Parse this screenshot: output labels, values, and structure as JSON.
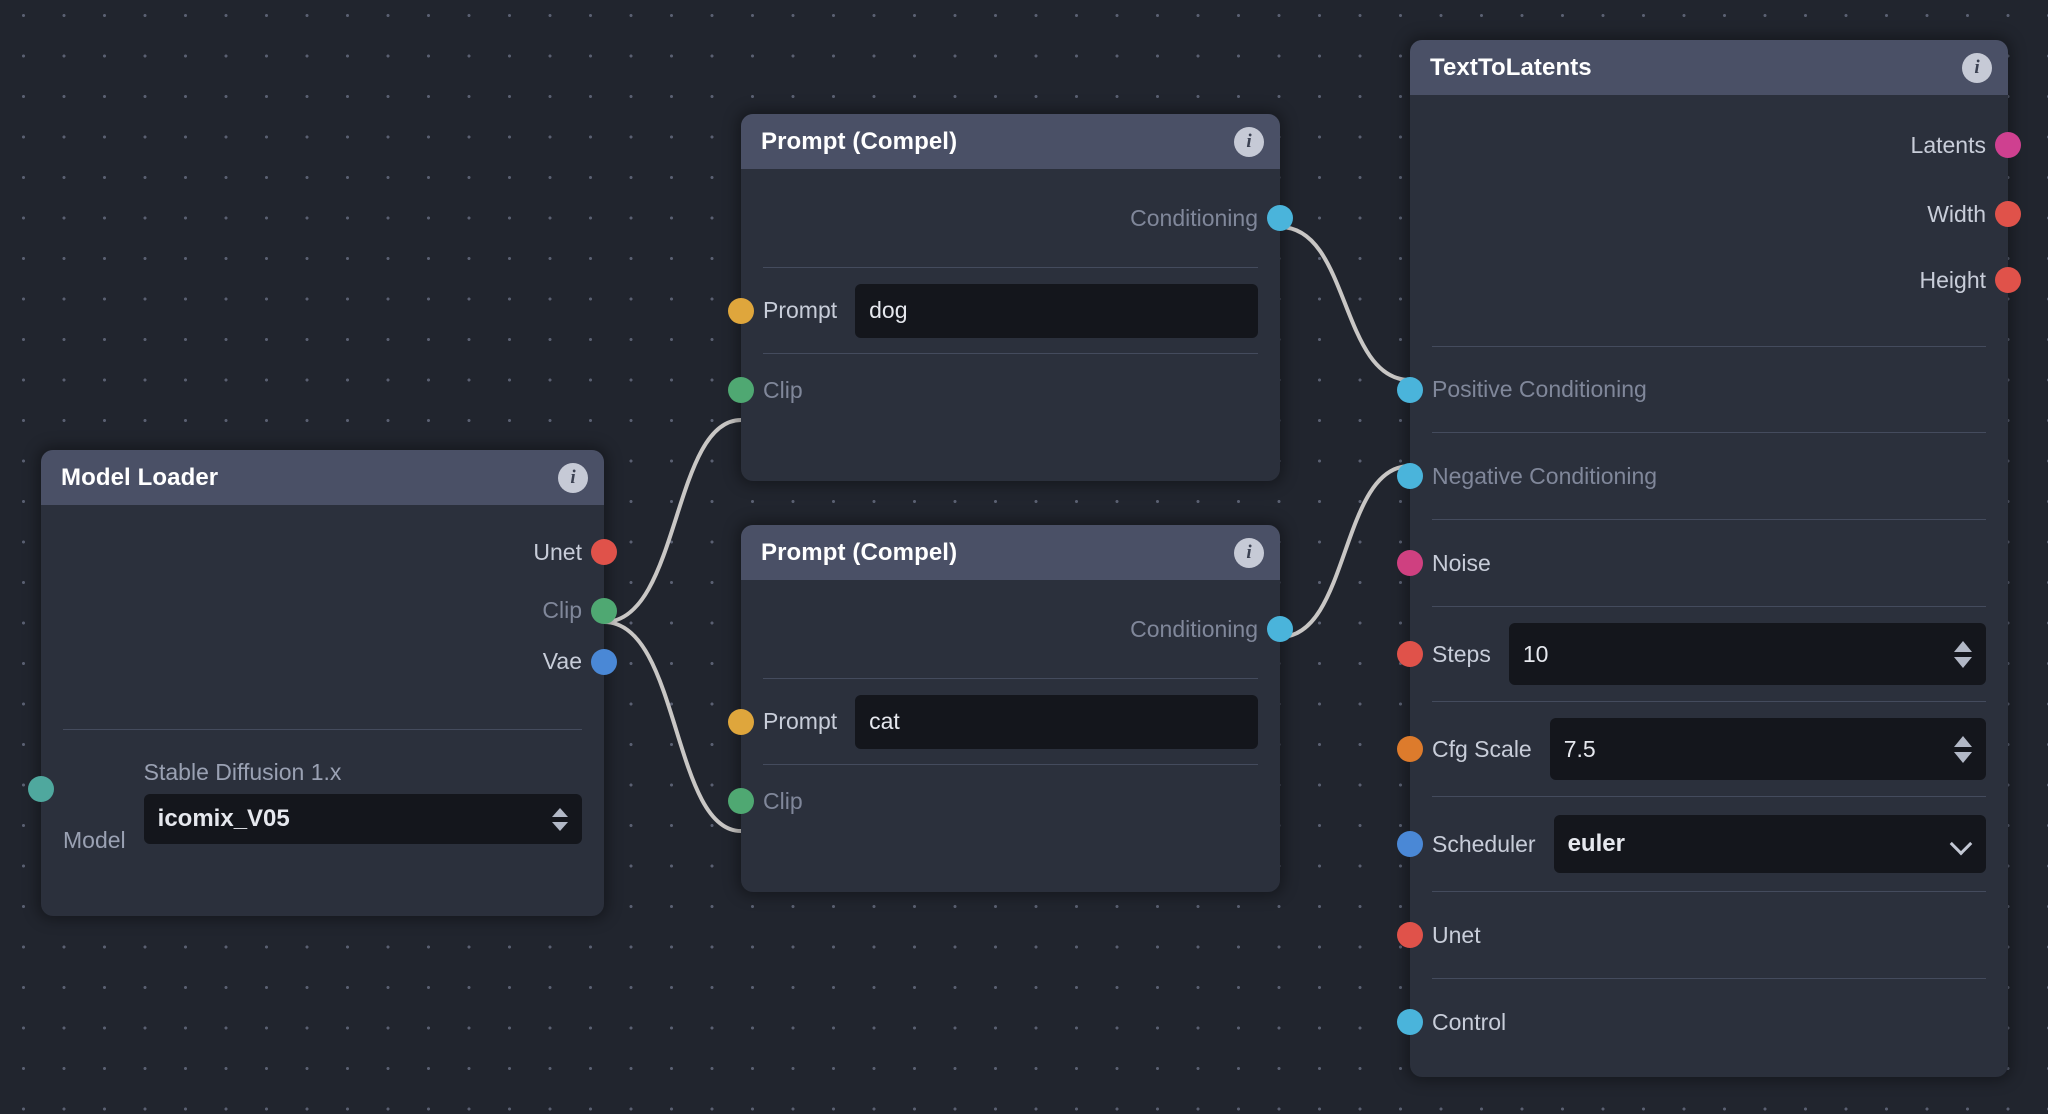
{
  "app": {
    "canvas_name": "node-graph-canvas",
    "background_color": "#21252e",
    "grid_dot_color": "#5a6072"
  },
  "socket_colors": {
    "unet": "#e0524a",
    "clip": "#4fa872",
    "vae": "#4a88d6",
    "model": "#4fa89e",
    "prompt": "#dfa63c",
    "conditioning": "#4ab4db",
    "latents": "#cf4090",
    "noise": "#cf4080",
    "width": "#e0524a",
    "height": "#e0524a",
    "steps": "#e0524a",
    "cfg_scale": "#dd7b2c",
    "scheduler": "#4a88d6",
    "control": "#4ab4db"
  },
  "nodes": {
    "model_loader": {
      "title": "Model Loader",
      "info_glyph": "i",
      "outputs": [
        {
          "label": "Unet",
          "socket": "unet",
          "state": "bright"
        },
        {
          "label": "Clip",
          "socket": "clip",
          "state": "dim"
        },
        {
          "label": "Vae",
          "socket": "vae",
          "state": "bright"
        }
      ],
      "model_input": {
        "socket": "model",
        "label": "Model",
        "base_model": "Stable Diffusion 1.x",
        "value": "icomix_V05"
      }
    },
    "prompt_positive": {
      "title": "Prompt (Compel)",
      "info_glyph": "i",
      "outputs": [
        {
          "label": "Conditioning",
          "socket": "conditioning",
          "state": "dim"
        }
      ],
      "inputs": [
        {
          "label": "Prompt",
          "socket": "prompt",
          "state": "bright",
          "value": "dog"
        },
        {
          "label": "Clip",
          "socket": "clip",
          "state": "dim"
        }
      ]
    },
    "prompt_negative": {
      "title": "Prompt (Compel)",
      "info_glyph": "i",
      "outputs": [
        {
          "label": "Conditioning",
          "socket": "conditioning",
          "state": "dim"
        }
      ],
      "inputs": [
        {
          "label": "Prompt",
          "socket": "prompt",
          "state": "bright",
          "value": "cat"
        },
        {
          "label": "Clip",
          "socket": "clip",
          "state": "dim"
        }
      ]
    },
    "text_to_latents": {
      "title": "TextToLatents",
      "info_glyph": "i",
      "outputs": [
        {
          "label": "Latents",
          "socket": "latents",
          "state": "bright"
        },
        {
          "label": "Width",
          "socket": "width",
          "state": "bright"
        },
        {
          "label": "Height",
          "socket": "height",
          "state": "bright"
        }
      ],
      "inputs": [
        {
          "label": "Positive Conditioning",
          "socket": "conditioning",
          "state": "dim"
        },
        {
          "label": "Negative Conditioning",
          "socket": "conditioning",
          "state": "dim"
        },
        {
          "label": "Noise",
          "socket": "noise",
          "state": "bright"
        },
        {
          "label": "Steps",
          "socket": "steps",
          "state": "bright",
          "value": "10",
          "control": "spinner"
        },
        {
          "label": "Cfg Scale",
          "socket": "cfg_scale",
          "state": "bright",
          "value": "7.5",
          "control": "spinner"
        },
        {
          "label": "Scheduler",
          "socket": "scheduler",
          "state": "bright",
          "value": "euler",
          "control": "select"
        },
        {
          "label": "Unet",
          "socket": "unet",
          "state": "bright"
        },
        {
          "label": "Control",
          "socket": "control",
          "state": "bright"
        }
      ]
    }
  }
}
